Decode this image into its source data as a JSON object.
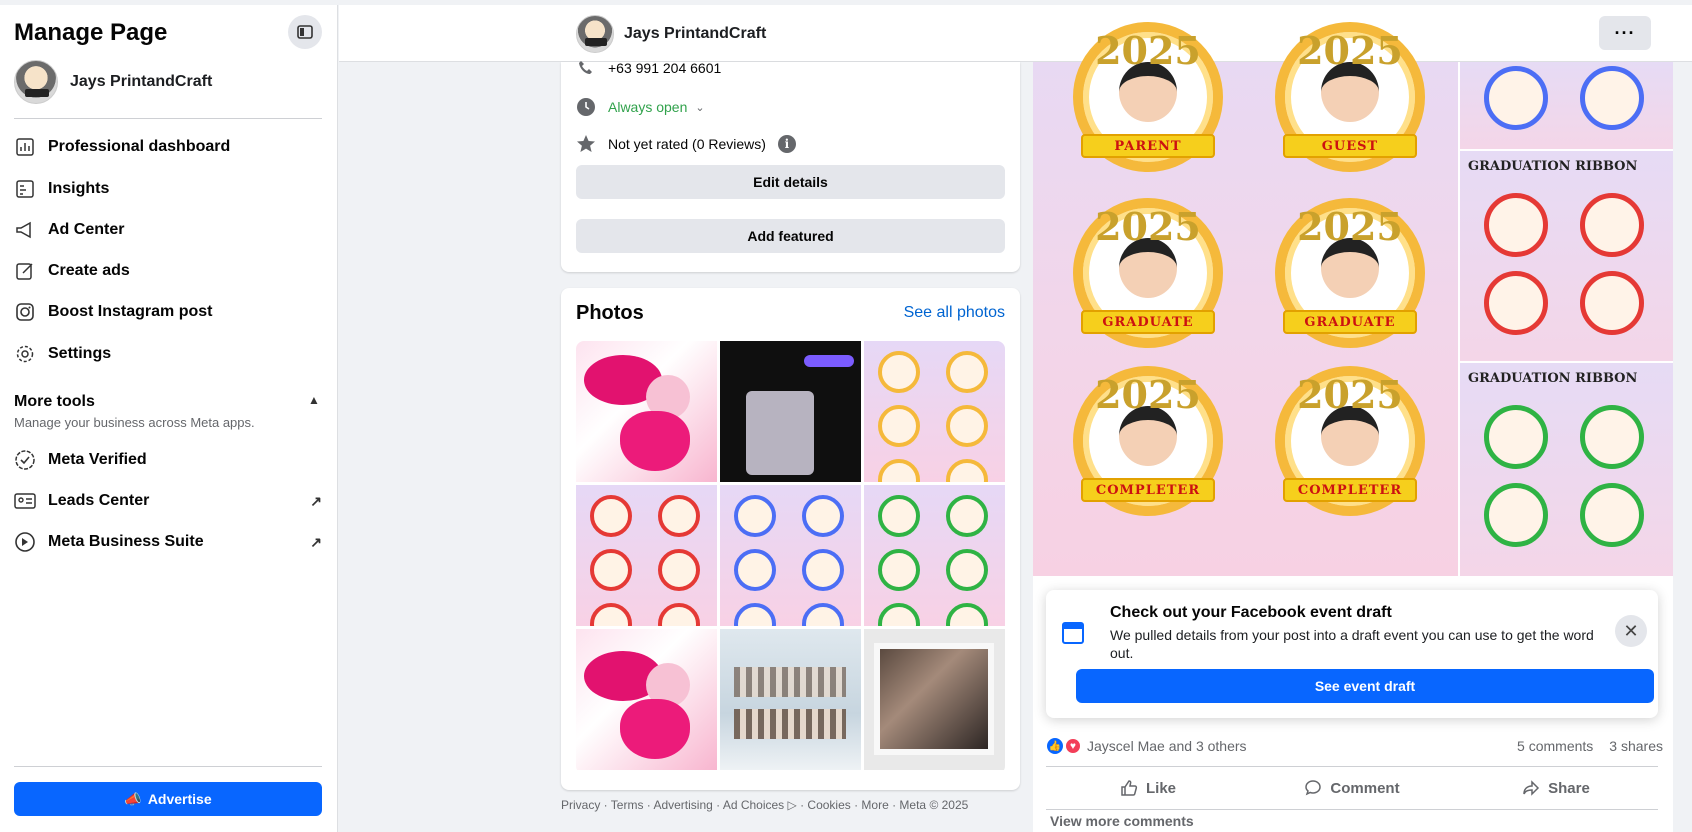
{
  "sidebar": {
    "title": "Manage Page",
    "page_name": "Jays PrintandCraft",
    "items": [
      {
        "label": "Professional dashboard"
      },
      {
        "label": "Insights"
      },
      {
        "label": "Ad Center"
      },
      {
        "label": "Create ads"
      },
      {
        "label": "Boost Instagram post"
      },
      {
        "label": "Settings"
      }
    ],
    "more_tools": {
      "title": "More tools",
      "subtitle": "Manage your business across Meta apps."
    },
    "tools": [
      {
        "label": "Meta Verified"
      },
      {
        "label": "Leads Center"
      },
      {
        "label": "Meta Business Suite"
      }
    ],
    "advertise_label": "Advertise"
  },
  "header": {
    "page_name": "Jays PrintandCraft",
    "menu_label": "···"
  },
  "intro": {
    "phone": "+63 991 204 6601",
    "hours": "Always open",
    "rating": "Not yet rated (0 Reviews)",
    "edit_label": "Edit details",
    "featured_label": "Add featured"
  },
  "photos": {
    "title": "Photos",
    "see_all": "See all photos"
  },
  "footer": "Privacy · Terms · Advertising · Ad Choices ▷ · Cookies · More · Meta © 2025",
  "post": {
    "badges": {
      "year": "2025",
      "parent": "PARENT",
      "guest": "GUEST",
      "graduate": "GRADUATE",
      "completer": "COMPLETER"
    },
    "tile_caption": "GRADUATION RIBBON",
    "event": {
      "title": "Check out your Facebook event draft",
      "desc": "We pulled details from your post into a draft event you can use to get the word out.",
      "button": "See event draft"
    },
    "reactions_text": "Jayscel Mae and 3 others",
    "comments": "5 comments",
    "shares": "3 shares",
    "actions": {
      "like": "Like",
      "comment": "Comment",
      "share": "Share"
    },
    "view_more": "View more comments"
  },
  "colors": {
    "accent": "#0866ff",
    "open_green": "#31a24c",
    "link": "#0064d1"
  }
}
